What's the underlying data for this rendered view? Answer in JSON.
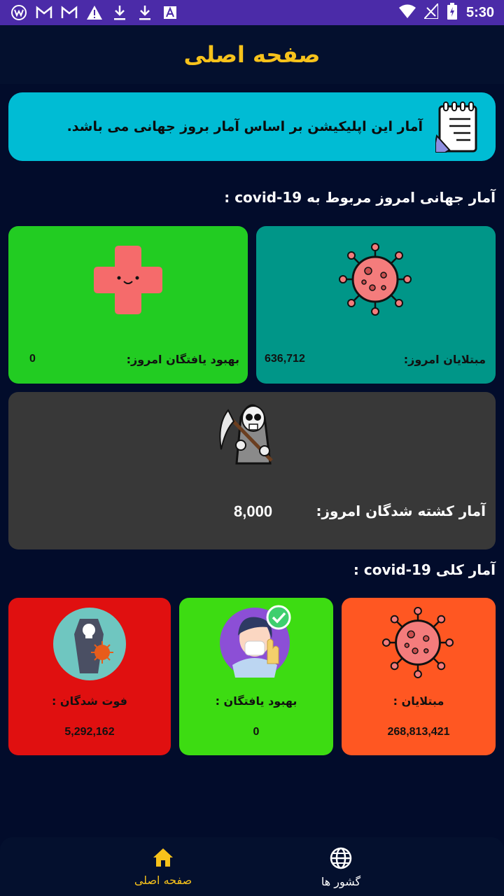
{
  "status_bar": {
    "time": "5:30",
    "icons": [
      "w-circle-icon",
      "gmail-icon",
      "gmail-icon",
      "warning-icon",
      "download-icon",
      "download-icon",
      "font-icon"
    ],
    "right_icons": [
      "wifi-icon",
      "no-signal-icon",
      "battery-charging-icon"
    ]
  },
  "app_bar": {
    "title": "صفحه اصلی"
  },
  "notice": {
    "text": "آمار این اپلیکیشن بر اساس آمار بروز جهانی می باشد.",
    "icon": "notepad-icon"
  },
  "today": {
    "section_title": "آمار جهانی امروز مربوط به covid-19 :",
    "infected": {
      "label": "مبتلایان امروز:",
      "value": "636,712",
      "icon": "virus-icon",
      "color": "#009688"
    },
    "recovered": {
      "label": "بهبود یافتگان امروز:",
      "value": "0",
      "icon": "medical-cross-icon",
      "color": "#22cc22"
    },
    "deaths": {
      "label": "آمار کشته شدگان امروز:",
      "value": "8,000",
      "icon": "grim-reaper-icon",
      "color": "#383838"
    }
  },
  "total": {
    "section_title": "آمار کلی covid-19 :",
    "infected": {
      "label": "مبتلایان :",
      "value": "268,813,421",
      "icon": "virus-icon",
      "color": "#ff5722"
    },
    "recovered": {
      "label": "بهبود یافتگان :",
      "value": "0",
      "icon": "recovered-patient-icon",
      "color": "#3ddc12"
    },
    "deaths": {
      "label": "فوت شدگان :",
      "value": "5,292,162",
      "icon": "coffin-icon",
      "color": "#e01010"
    }
  },
  "bottom_nav": {
    "items": [
      {
        "label": "صفحه اصلی",
        "icon": "home-icon",
        "active": true,
        "color": "#f7c21b"
      },
      {
        "label": "گشور ها",
        "icon": "globe-icon",
        "active": false,
        "color": "#ffffff"
      }
    ]
  }
}
